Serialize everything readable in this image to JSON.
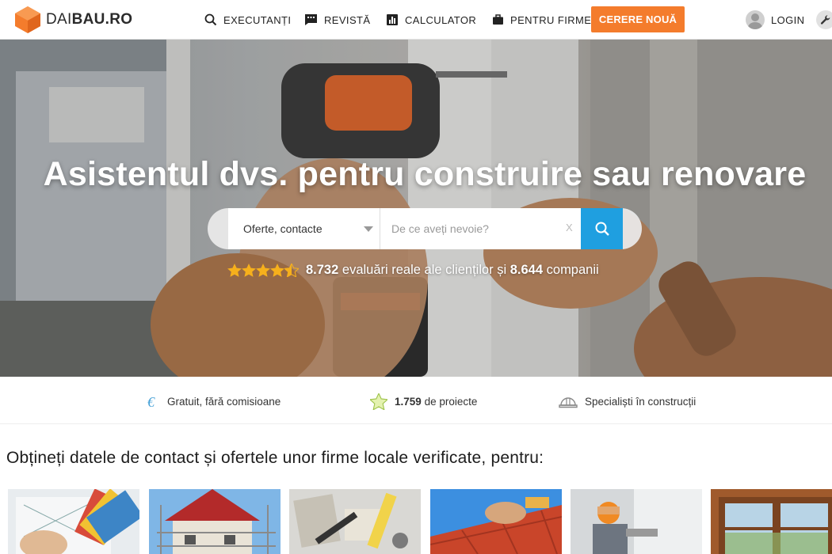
{
  "header": {
    "logo_light": "DAI",
    "logo_bold": "BAU.RO",
    "nav": [
      {
        "label": "EXECUTANȚI",
        "icon": "search-icon"
      },
      {
        "label": "REVISTĂ",
        "icon": "comment-icon"
      },
      {
        "label": "CALCULATOR",
        "icon": "bar-chart-icon"
      },
      {
        "label": "PENTRU FIRME",
        "icon": "briefcase-icon"
      }
    ],
    "cta_label": "CERERE NOUĂ",
    "login_label": "LOGIN",
    "colors": {
      "accent": "#f47c2c",
      "search_button": "#1f9fe0"
    }
  },
  "hero": {
    "title": "Asistentul dvs. pentru construire sau renovare",
    "search": {
      "select_value": "Oferte, contacte",
      "input_placeholder": "De ce aveți nevoie?",
      "clear_label": "X"
    },
    "rating": {
      "stars": 4.5,
      "reviews_count": "8.732",
      "reviews_text": "evaluări reale ale clienților și",
      "companies_count": "8.644",
      "companies_text": "companii"
    }
  },
  "features": [
    {
      "icon": "euro-icon",
      "text": "Gratuit, fără comisioane"
    },
    {
      "icon": "star-icon",
      "count": "1.759",
      "text": "de proiecte"
    },
    {
      "icon": "helmet-icon",
      "text": "Specialiști în construcții"
    }
  ],
  "section": {
    "title": "Obțineți datele de contact și ofertele unor firme locale verificate, pentru:",
    "cards": [
      {
        "name": "card-design"
      },
      {
        "name": "card-house-construction"
      },
      {
        "name": "card-renovation-tools"
      },
      {
        "name": "card-roofing"
      },
      {
        "name": "card-finishing-works"
      },
      {
        "name": "card-windows"
      }
    ]
  }
}
